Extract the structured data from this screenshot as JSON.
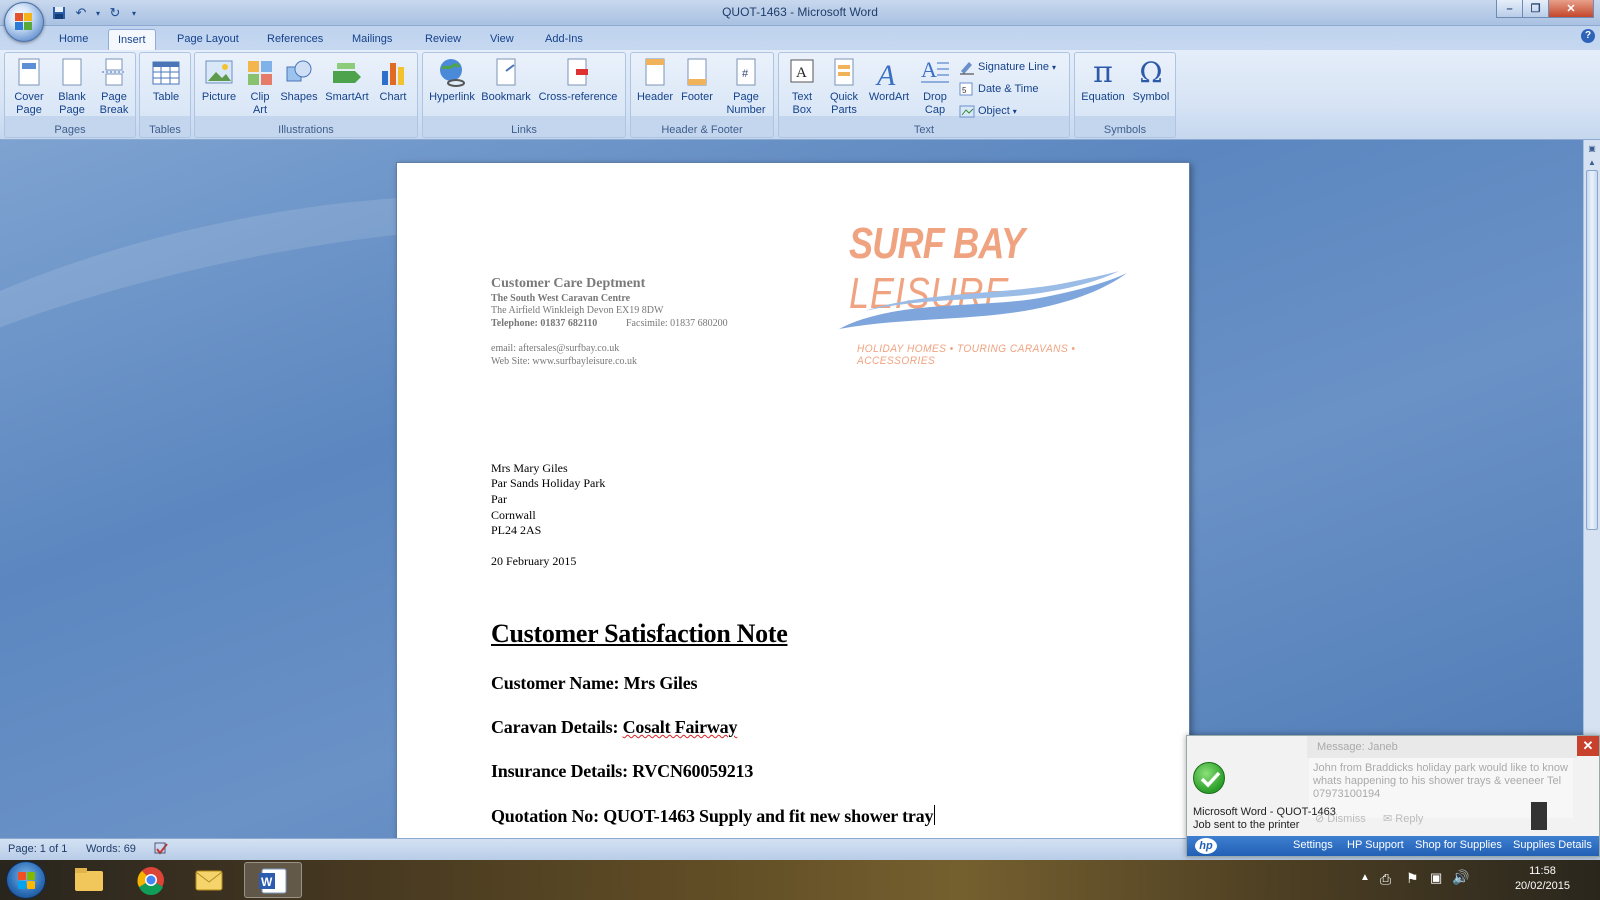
{
  "window": {
    "title": "QUOT-1463 - Microsoft Word"
  },
  "tabs": [
    "Home",
    "Insert",
    "Page Layout",
    "References",
    "Mailings",
    "Review",
    "View",
    "Add-Ins"
  ],
  "active_tab": "Insert",
  "ribbon": {
    "pages": {
      "label": "Pages",
      "cover_page": "Cover\nPage",
      "blank_page": "Blank\nPage",
      "page_break": "Page\nBreak"
    },
    "tables": {
      "label": "Tables",
      "table": "Table"
    },
    "illustrations": {
      "label": "Illustrations",
      "picture": "Picture",
      "clip_art": "Clip\nArt",
      "shapes": "Shapes",
      "smartart": "SmartArt",
      "chart": "Chart"
    },
    "links": {
      "label": "Links",
      "hyperlink": "Hyperlink",
      "bookmark": "Bookmark",
      "cross_reference": "Cross-reference"
    },
    "header_footer": {
      "label": "Header & Footer",
      "header": "Header",
      "footer": "Footer",
      "page_number": "Page\nNumber"
    },
    "text": {
      "label": "Text",
      "text_box": "Text\nBox",
      "quick_parts": "Quick\nParts",
      "wordart": "WordArt",
      "drop_cap": "Drop\nCap",
      "signature_line": "Signature Line",
      "date_time": "Date & Time",
      "object": "Object"
    },
    "symbols": {
      "label": "Symbols",
      "equation": "Equation",
      "symbol": "Symbol"
    }
  },
  "document": {
    "dept": "Customer Care Deptment",
    "company": "The South West Caravan Centre",
    "address": "The Airfield Winkleigh Devon EX19 8DW",
    "telephone": "Telephone: 01837 682110",
    "facsimile": "Facsimile: 01837 680200",
    "email": "email: aftersales@surfbay.co.uk",
    "website": "Web Site: www.surfbayleisure.co.uk",
    "logo_word_bold": "SURF BAY",
    "logo_word_light": "LEISURE",
    "logo_tagline": "HOLIDAY HOMES • TOURING CARAVANS • ACCESSORIES",
    "recipient": [
      "Mrs Mary Giles",
      "Par Sands Holiday Park",
      "Par",
      "Cornwall",
      "PL24 2AS"
    ],
    "date": "20 February 2015",
    "note_title": "Customer Satisfaction Note",
    "customer_name": "Customer Name:  Mrs Giles",
    "caravan_label": "Caravan Details: ",
    "caravan_value": "Cosalt Fairway",
    "insurance": "Insurance Details:  RVCN60059213",
    "quotation": "Quotation No: QUOT-1463 Supply and fit new shower tray"
  },
  "status": {
    "page": "Page: 1 of 1",
    "words": "Words: 69"
  },
  "notification": {
    "message_title": "Message: Janeb",
    "message_body": "John from Braddicks holiday park   would like to know whats happening to his shower trays & veeneer Tel 07973100194",
    "job_line1": "Microsoft Word - QUOT-1463",
    "job_line2": "Job sent to the printer",
    "dismiss": "Dismiss",
    "reply": "Reply",
    "bar_settings": "Settings",
    "bar_support": "HP Support",
    "bar_shop": "Shop for Supplies",
    "bar_details": "Supplies Details"
  },
  "taskbar": {
    "time": "11:58",
    "date": "20/02/2015"
  },
  "colors": {
    "logo_orange": "#f0a380",
    "logo_blue": "#7ea6dd",
    "ribbon_text": "#15428b"
  }
}
